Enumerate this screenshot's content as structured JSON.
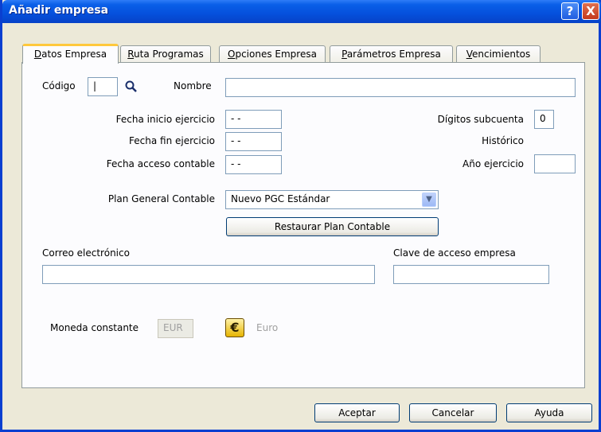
{
  "window": {
    "title": "Añadir empresa",
    "help": "?",
    "close": "X"
  },
  "tabs": [
    {
      "pre": "",
      "key": "D",
      "post": "atos Empresa"
    },
    {
      "pre": "",
      "key": "R",
      "post": "uta Programas"
    },
    {
      "pre": "",
      "key": "O",
      "post": "pciones Empresa"
    },
    {
      "pre": "",
      "key": "P",
      "post": "arámetros Empresa"
    },
    {
      "pre": "",
      "key": "V",
      "post": "encimientos"
    }
  ],
  "form": {
    "codigo_label": "Código",
    "codigo_value": "|",
    "nombre_label": "Nombre",
    "nombre_value": "",
    "fecha_inicio_label": "Fecha inicio ejercicio",
    "fecha_inicio_value": "-  -",
    "fecha_fin_label": "Fecha fin ejercicio",
    "fecha_fin_value": "-  -",
    "fecha_acceso_label": "Fecha acceso contable",
    "fecha_acceso_value": "-  -",
    "digitos_label": "Dígitos subcuenta",
    "digitos_value": "0",
    "historico_label": "Histórico",
    "ano_label": "Año ejercicio",
    "ano_value": "",
    "plan_label": "Plan General Contable",
    "plan_value": "Nuevo PGC Estándar",
    "restaurar_label": "Restaurar Plan Contable",
    "correo_label": "Correo electrónico",
    "correo_value": "",
    "clave_label": "Clave de acceso empresa",
    "clave_value": "",
    "moneda_label": "Moneda constante",
    "moneda_value": "EUR",
    "euro_symbol": "€",
    "euro_label": "Euro"
  },
  "buttons": {
    "aceptar": "Aceptar",
    "cancelar": "Cancelar",
    "ayuda": "Ayuda"
  }
}
